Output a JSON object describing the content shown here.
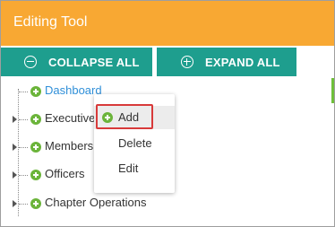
{
  "header": {
    "title": "Editing Tool"
  },
  "toolbar": {
    "collapse_label": "COLLAPSE ALL",
    "expand_label": "EXPAND ALL"
  },
  "tree": {
    "nodes": [
      {
        "label": "Dashboard"
      },
      {
        "label": "Executive"
      },
      {
        "label": "Membersh"
      },
      {
        "label": "Officers"
      },
      {
        "label": "Chapter Operations"
      }
    ]
  },
  "context_menu": {
    "items": [
      {
        "label": "Add"
      },
      {
        "label": "Delete"
      },
      {
        "label": "Edit"
      }
    ]
  },
  "colors": {
    "header": "#f8a833",
    "toolbar_button": "#1e9e8e",
    "node_icon": "#6bb43a",
    "link": "#2f8fd8",
    "highlight_outline": "#d83a3a"
  }
}
